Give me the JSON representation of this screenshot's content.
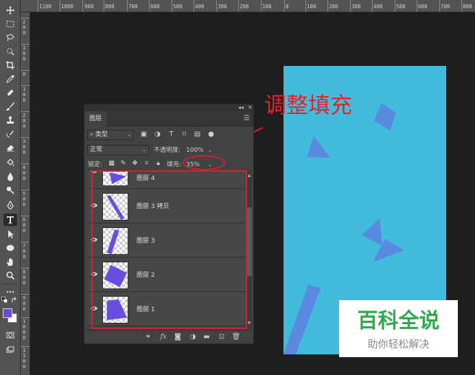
{
  "ruler": {
    "top_ticks": [
      "1100",
      "1000",
      "900",
      "800",
      "700",
      "600",
      "500",
      "400",
      "300",
      "200",
      "100",
      "0",
      "100",
      "200",
      "300",
      "400",
      "500",
      "600",
      "700",
      "800"
    ],
    "left_ticks": [
      "2 0 0",
      "1 0 0",
      "0",
      "1 0 0",
      "2 0 0",
      "3 0 0",
      "4 0 0",
      "5 0 0",
      "6 0 0",
      "7 0 0",
      "8 0 0",
      "9 0 0",
      "1 0 0 0",
      "1 1 0 0"
    ]
  },
  "annotation": {
    "title": "调整填充"
  },
  "panel": {
    "tab_label": "图层",
    "filter_kind": "类型",
    "blend_mode": "正常",
    "opacity_label": "不透明度:",
    "opacity_value": "100%",
    "lock_label": "锁定:",
    "fill_label": "填充:",
    "fill_value": "35%",
    "layers": [
      {
        "name": "图层 4"
      },
      {
        "name": "图层 3 拷贝"
      },
      {
        "name": "图层 3"
      },
      {
        "name": "图层 2"
      },
      {
        "name": "图层 1"
      }
    ]
  },
  "colors": {
    "foreground": "#6a4ce0",
    "background": "#ffffff",
    "canvas": "#41bcdc",
    "shape": "#5a8ae0",
    "highlight": "#d2232a",
    "watermark_green": "#2faa4a"
  },
  "watermark": {
    "title": "百科全说",
    "subtitle": "助你轻松解决"
  }
}
